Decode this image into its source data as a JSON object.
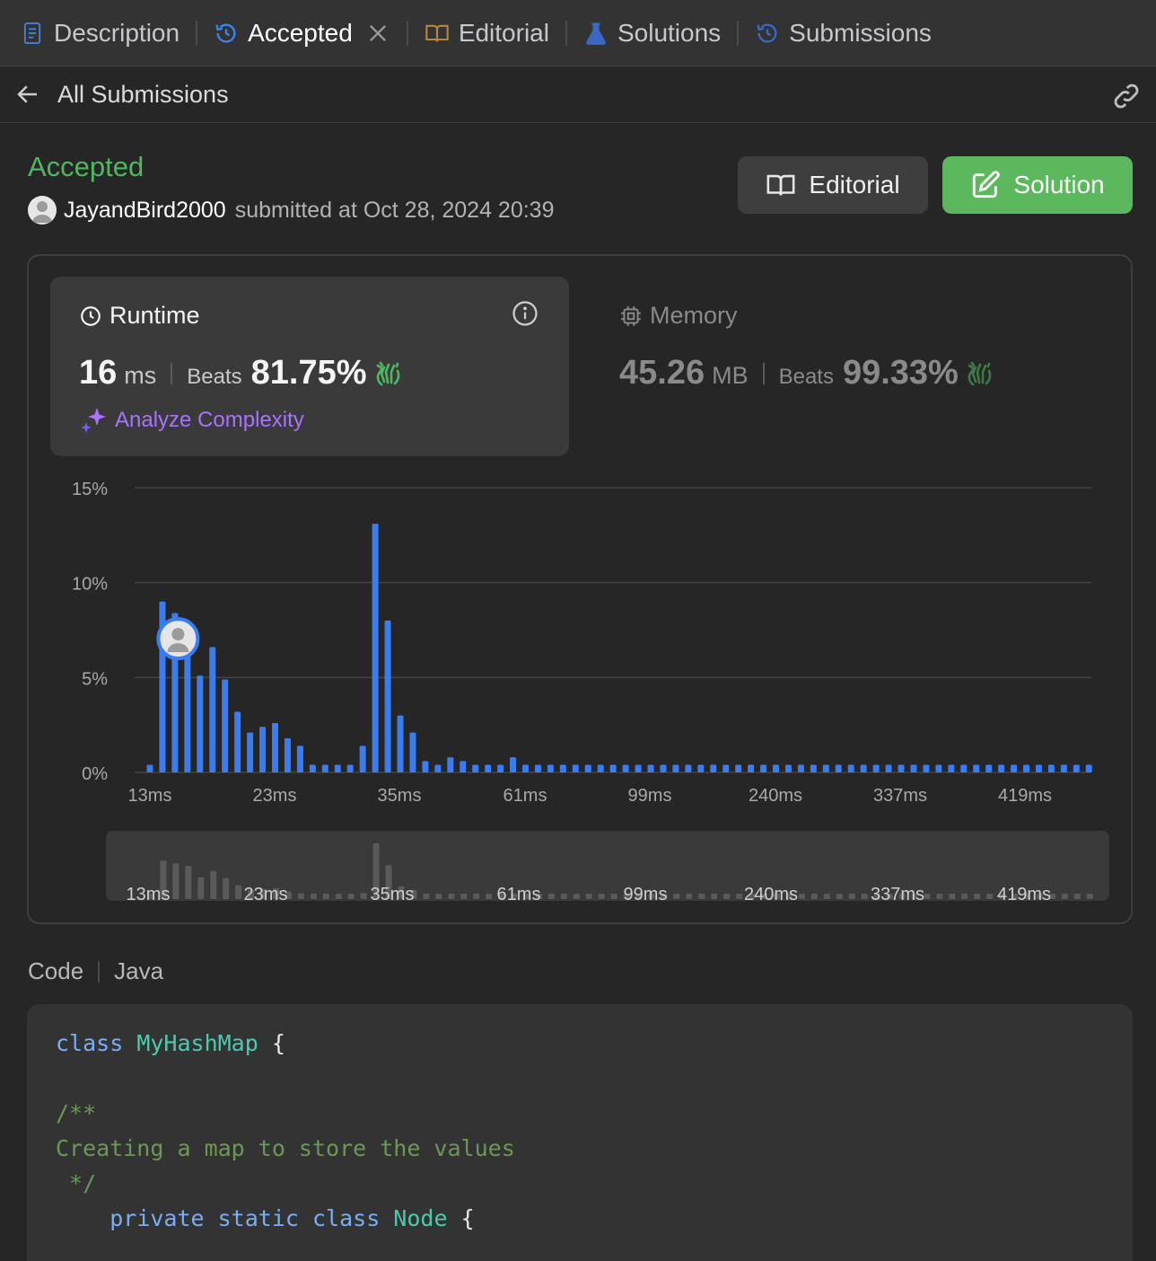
{
  "tabs": [
    {
      "label": "Description",
      "icon": "description-icon",
      "active": false
    },
    {
      "label": "Accepted",
      "icon": "history-icon",
      "active": true
    },
    {
      "label": "Editorial",
      "icon": "book-icon",
      "active": false
    },
    {
      "label": "Solutions",
      "icon": "flask-icon",
      "active": false
    },
    {
      "label": "Submissions",
      "icon": "history-icon",
      "active": false
    }
  ],
  "subheader": {
    "back_label": "All Submissions"
  },
  "submission": {
    "status": "Accepted",
    "user": "JayandBird2000",
    "submitted_text": "submitted at Oct 28, 2024 20:39"
  },
  "actions": {
    "editorial_label": "Editorial",
    "solution_label": "Solution"
  },
  "runtime": {
    "title": "Runtime",
    "value": "16",
    "unit": "ms",
    "beats_label": "Beats",
    "beats": "81.75%",
    "analyze_label": "Analyze Complexity"
  },
  "memory": {
    "title": "Memory",
    "value": "45.26",
    "unit": "MB",
    "beats_label": "Beats",
    "beats": "99.33%"
  },
  "colors": {
    "accent_green": "#5cb85c",
    "bar_blue": "#3a7df3",
    "purple": "#a773ff"
  },
  "chart_data": {
    "type": "bar",
    "y_ticks": [
      "15%",
      "10%",
      "5%",
      "0%"
    ],
    "ylim": [
      0,
      15
    ],
    "x_tick_labels": [
      "13ms",
      "23ms",
      "35ms",
      "61ms",
      "99ms",
      "240ms",
      "337ms",
      "419ms"
    ],
    "values": [
      0.4,
      9.0,
      8.4,
      7.8,
      5.1,
      6.6,
      4.9,
      3.2,
      2.1,
      2.4,
      2.6,
      1.8,
      1.4,
      0.4,
      0.4,
      0.4,
      0.4,
      1.4,
      13.1,
      8.0,
      3.0,
      2.1,
      0.6,
      0.4,
      0.8,
      0.6,
      0.4,
      0.4,
      0.4,
      0.8,
      0.4,
      0.4,
      0.4,
      0.4,
      0.4,
      0.4,
      0.4,
      0.4,
      0.4,
      0.4,
      0.4,
      0.4,
      0.4,
      0.4,
      0.4,
      0.4,
      0.4,
      0.4,
      0.4,
      0.4,
      0.4,
      0.4,
      0.4,
      0.4,
      0.4,
      0.4,
      0.4,
      0.4,
      0.4,
      0.4,
      0.4,
      0.4,
      0.4,
      0.4,
      0.4,
      0.4,
      0.4,
      0.4,
      0.4,
      0.4,
      0.4,
      0.4,
      0.4,
      0.4,
      0.4,
      0.4
    ],
    "user_bar_index": 3,
    "grid": true
  },
  "code_section": {
    "label": "Code",
    "language": "Java",
    "lines": [
      [
        {
          "t": "class ",
          "c": "kw"
        },
        {
          "t": "MyHashMap",
          "c": "cls"
        },
        {
          "t": " {",
          "c": "pun"
        }
      ],
      [],
      [
        {
          "t": "/**",
          "c": "cmt"
        }
      ],
      [
        {
          "t": "Creating a map to store the values",
          "c": "cmt"
        }
      ],
      [
        {
          "t": " */",
          "c": "cmt"
        }
      ],
      [
        {
          "t": "    ",
          "c": "pun"
        },
        {
          "t": "private static class ",
          "c": "kw"
        },
        {
          "t": "Node",
          "c": "cls"
        },
        {
          "t": " {",
          "c": "pun"
        }
      ]
    ]
  }
}
